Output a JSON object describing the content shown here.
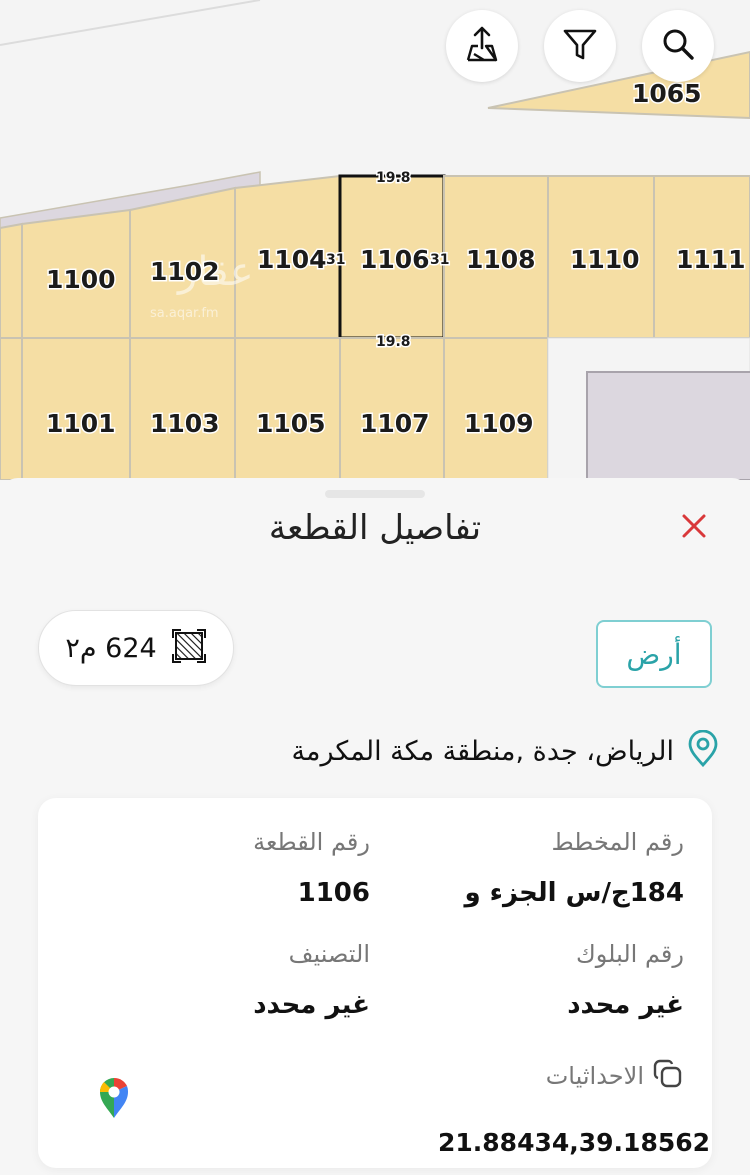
{
  "map": {
    "plots_top": [
      "1100",
      "1102",
      "1104",
      "1106",
      "1108",
      "1110",
      "1111"
    ],
    "plots_bottom": [
      "1101",
      "1103",
      "1105",
      "1107",
      "1109"
    ],
    "plot_corner": "1065",
    "selected_dims": {
      "top": "19.8",
      "bottom": "19.8",
      "left": "31",
      "right": "31"
    },
    "watermark": "sa.aqar.fm",
    "colors": {
      "plot_fill": "#f5dea4",
      "plot_border": "#c9c3b2",
      "grey_block": "#dcd7df",
      "selected_border": "#111111"
    }
  },
  "toolbar": {
    "share_icon": "share-upload-icon",
    "filter_icon": "filter-icon",
    "search_icon": "search-icon"
  },
  "sheet": {
    "title": "تفاصيل القطعة",
    "close_icon": "close-icon",
    "area": "624 م٢",
    "area_icon": "area-hatch-icon",
    "type": "أرض",
    "location": "الرياض، جدة ,منطقة مكة المكرمة",
    "location_icon": "location-pin-icon",
    "details": {
      "plan_label": "رقم المخطط",
      "plan_value": "184ج/س الجزء و",
      "plot_label": "رقم القطعة",
      "plot_value": "1106",
      "block_label": "رقم البلوك",
      "block_value": "غير محدد",
      "class_label": "التصنيف",
      "class_value": "غير محدد",
      "coords_label": "الاحداثيات",
      "coords_value": "21.88434,39.18562",
      "copy_icon": "copy-icon",
      "maps_icon": "google-maps-pin-icon"
    },
    "colors": {
      "accent": "#2aa3a8",
      "close": "#d9383a"
    }
  }
}
